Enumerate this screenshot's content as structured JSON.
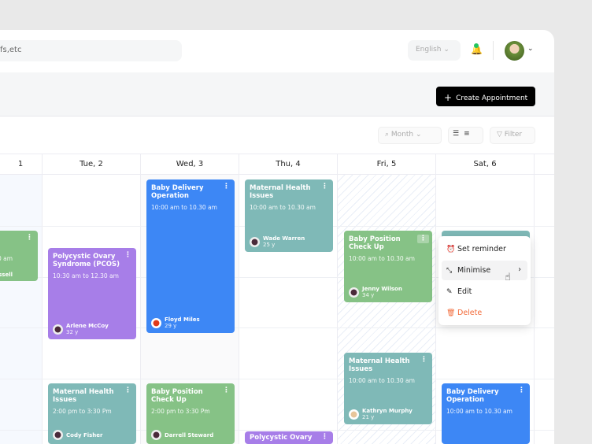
{
  "topbar": {
    "search_placeholder": "fs,etc",
    "language": "English",
    "language_chevron": "⌄",
    "profile_chevron": "⌄"
  },
  "actions": {
    "create_label": "Create Appointment",
    "create_icon": "+"
  },
  "toolbar": {
    "view_select": "Month",
    "filter_label": "Filter"
  },
  "days": [
    "1",
    "Tue, 2",
    "Wed, 3",
    "Thu, 4",
    "Fri, 5",
    "Sat, 6"
  ],
  "cards": {
    "c0": {
      "time": "0 am",
      "name": "ssell"
    },
    "c1": {
      "title": "Polycystic Ovary Syndrome (PCOS)",
      "time": "10:30 am to 12.30 am",
      "name": "Arlene McCoy",
      "age": "32 y"
    },
    "c2": {
      "title": "Maternal Health Issues",
      "time": "2:00 pm to 3:30 Pm",
      "name": "Cody Fisher"
    },
    "c3": {
      "title": "Baby Delivery Operation",
      "time": "10:00 am to 10.30 am",
      "name": "Floyd Miles",
      "age": "29 y"
    },
    "c4": {
      "title": "Baby Position Check Up",
      "time": "2:00 pm to 3:30 Pm",
      "name": "Darrell Steward"
    },
    "c5": {
      "title": "Maternal Health Issues",
      "time": "10:00 am to 10.30 am",
      "name": "Wade Warren",
      "age": "25 y"
    },
    "c6": {
      "title": "Polycystic Ovary"
    },
    "c7": {
      "title": "Baby Position Check Up",
      "time": "10:00 am to 10.30 am",
      "name": "Jenny Wilson",
      "age": "34 y"
    },
    "c8": {
      "title": "Maternal Health Issues",
      "time": "10:00 am to 10.30 am",
      "name": "Kathryn Murphy",
      "age": "21 y"
    },
    "c9": {
      "title": "Baby Delivery Operation",
      "time": "10:00 am to 10.30 am"
    }
  },
  "menu": {
    "set_reminder": "Set reminder",
    "minimise": "Minimise",
    "edit": "Edit",
    "delete": "Delete"
  },
  "colors": {
    "green": "#86c286",
    "purple": "#a77ee8",
    "blue": "#3d87f5",
    "teal": "#7fb9b7",
    "delete": "#f26b3a"
  }
}
